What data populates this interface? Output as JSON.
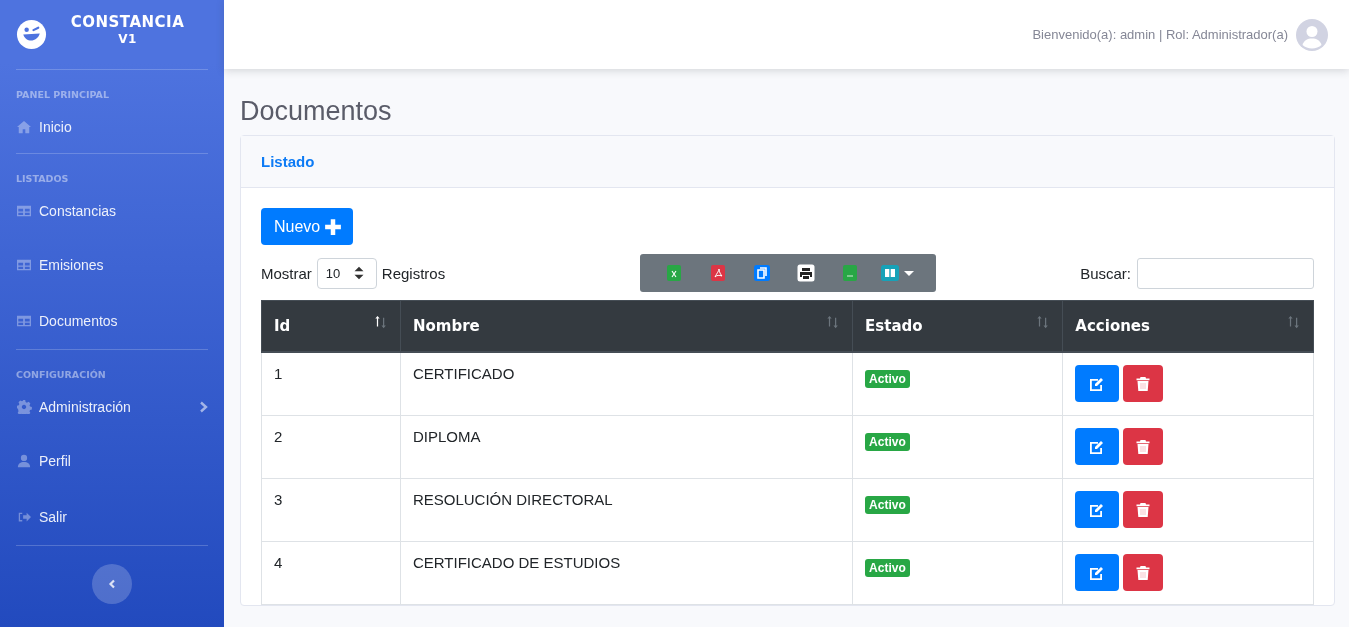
{
  "sidebar": {
    "brand": {
      "title": "CONSTANCIA",
      "version": "V1"
    },
    "sections": [
      {
        "heading": "PANEL PRINCIPAL",
        "items": [
          {
            "label": "Inicio",
            "kind": "home"
          }
        ]
      },
      {
        "heading": "LISTADOS",
        "items": [
          {
            "label": "Constancias",
            "kind": "table"
          },
          {
            "label": "Emisiones",
            "kind": "table"
          },
          {
            "label": "Documentos",
            "kind": "table"
          }
        ]
      },
      {
        "heading": "CONFIGURACIÓN",
        "items": [
          {
            "label": "Administración",
            "kind": "gear",
            "expanded": false
          },
          {
            "label": "Perfil",
            "kind": "user"
          },
          {
            "label": "Salir",
            "kind": "exit"
          }
        ]
      }
    ]
  },
  "topbar": {
    "user_text": "Bienvenido(a): admin | Rol: Administrador(a)"
  },
  "page_title": "Documentos",
  "card": {
    "header": "Listado",
    "new_button": "Nuevo",
    "length": {
      "label_before": "Mostrar",
      "value": "10",
      "label_after": "Registros"
    },
    "search": {
      "label": "Buscar:"
    },
    "table": {
      "columns": [
        {
          "label": "Id",
          "sorted": true
        },
        {
          "label": "Nombre",
          "sorted": false
        },
        {
          "label": "Estado",
          "sorted": false
        },
        {
          "label": "Acciones",
          "sorted": false
        }
      ],
      "rows": [
        {
          "id": "1",
          "name": "CERTIFICADO",
          "status": {
            "label": "Activo",
            "active": true
          }
        },
        {
          "id": "2",
          "name": "DIPLOMA",
          "status": {
            "label": "Activo",
            "active": true
          }
        },
        {
          "id": "3",
          "name": "RESOLUCIÓN DIRECTORAL",
          "status": {
            "label": "Activo",
            "active": true
          }
        },
        {
          "id": "4",
          "name": "CERTIFICADO DE ESTUDIOS",
          "status": {
            "label": "Activo",
            "active": true
          }
        }
      ]
    }
  }
}
